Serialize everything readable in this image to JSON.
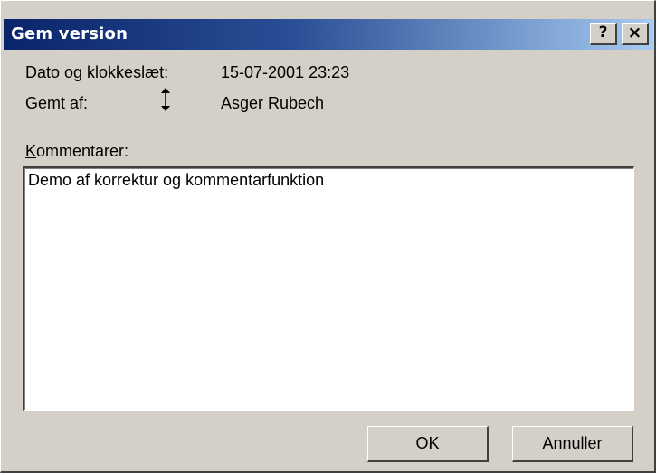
{
  "window": {
    "title": "Gem version",
    "help_label": "?",
    "close_label": "×"
  },
  "fields": {
    "date_label": "Dato og klokkeslæt:",
    "date_value": "15-07-2001 23:23",
    "saved_by_label": "Gemt af:",
    "saved_by_value": "Asger Rubech",
    "comments_label_first": "K",
    "comments_label_rest": "ommentarer:",
    "comments_value": "Demo af korrektur og kommentarfunktion"
  },
  "buttons": {
    "ok_label": "OK",
    "cancel_label": "Annuller"
  },
  "colors": {
    "title_start": "#0a246a",
    "title_end": "#a6caf0",
    "face": "#d4d0c8"
  },
  "icons": {
    "cursor": "resize-vertical-cursor-icon"
  }
}
